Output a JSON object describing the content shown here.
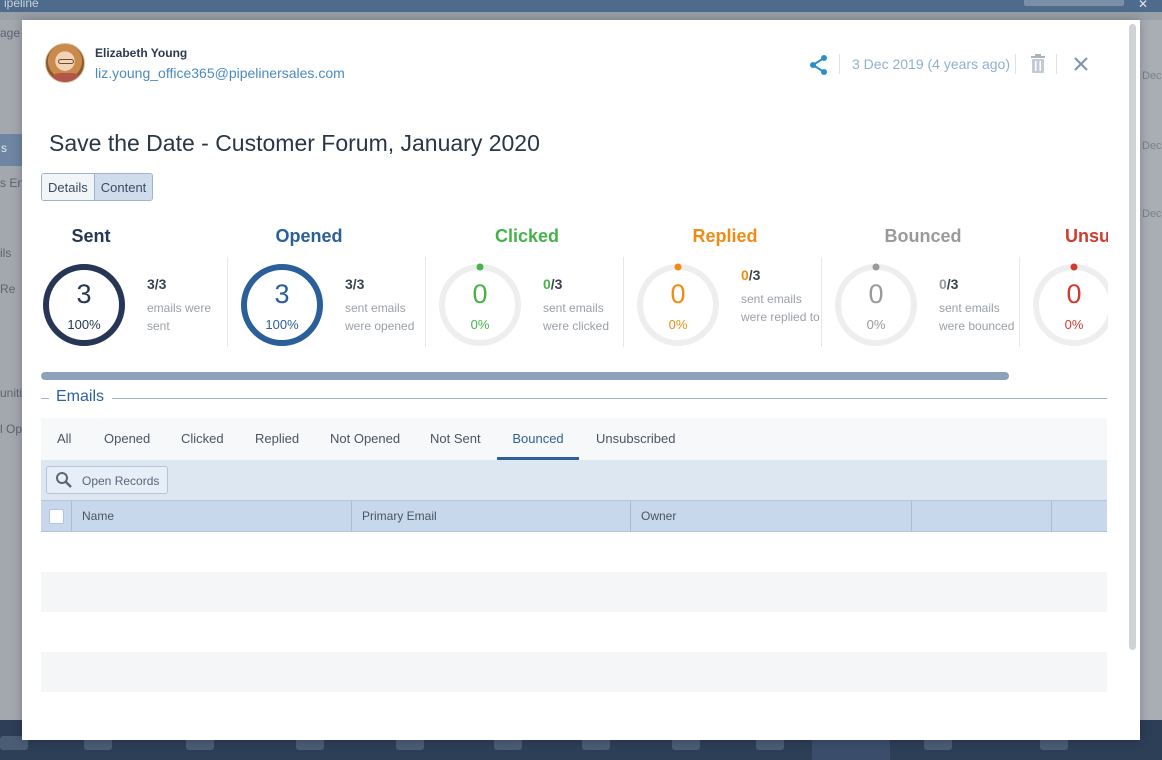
{
  "modal": {
    "sender": {
      "name": "Elizabeth Young",
      "email": "liz.young_office365@pipelinersales.com"
    },
    "date": "3 Dec 2019 (4 years ago)",
    "title": "Save the Date - Customer Forum, January 2020",
    "view_tabs": [
      {
        "label": "Details",
        "active": false
      },
      {
        "label": "Content",
        "active": true
      }
    ],
    "stats": [
      {
        "label": "Sent",
        "value": "3",
        "percent": "100%",
        "ratio_num": "3",
        "ratio_total": "/3",
        "desc": "emails were sent",
        "color": "#263654",
        "fraction": 1.0
      },
      {
        "label": "Opened",
        "value": "3",
        "percent": "100%",
        "ratio_num": "3",
        "ratio_total": "/3",
        "desc": "sent emails were opened",
        "color": "#2a5f99",
        "fraction": 1.0
      },
      {
        "label": "Clicked",
        "value": "0",
        "percent": "0%",
        "ratio_num": "0",
        "ratio_total": "/3",
        "desc": "sent emails were clicked",
        "color": "#46b34a",
        "fraction": 0
      },
      {
        "label": "Replied",
        "value": "0",
        "percent": "0%",
        "ratio_num": "0",
        "ratio_total": "/3",
        "desc": "sent emails were replied to",
        "color": "#f08c12",
        "fraction": 0
      },
      {
        "label": "Bounced",
        "value": "0",
        "percent": "0%",
        "ratio_num": "0",
        "ratio_total": "/3",
        "desc": "sent emails were bounced",
        "color": "#9a9a9a",
        "fraction": 0
      },
      {
        "label": "Unsu",
        "value": "0",
        "percent": "0%",
        "ratio_num": "",
        "ratio_total": "",
        "desc": "",
        "color": "#d23b2c",
        "fraction": 0
      }
    ],
    "emails_section": {
      "title": "Emails",
      "filter_tabs": [
        {
          "label": "All",
          "active": false
        },
        {
          "label": "Opened",
          "active": false
        },
        {
          "label": "Clicked",
          "active": false
        },
        {
          "label": "Replied",
          "active": false
        },
        {
          "label": "Not Opened",
          "active": false
        },
        {
          "label": "Not Sent",
          "active": false
        },
        {
          "label": "Bounced",
          "active": true
        },
        {
          "label": "Unsubscribed",
          "active": false
        }
      ],
      "open_records_label": "Open Records",
      "columns": [
        "Name",
        "Primary Email",
        "Owner",
        "",
        ""
      ]
    }
  },
  "colors": {
    "accent": "#2f6196",
    "link": "#4a8bbf",
    "date": "#8fb0cf"
  },
  "icons": {
    "share": "share-icon",
    "delete": "trash-icon",
    "close": "close-icon",
    "search": "search-icon"
  }
}
